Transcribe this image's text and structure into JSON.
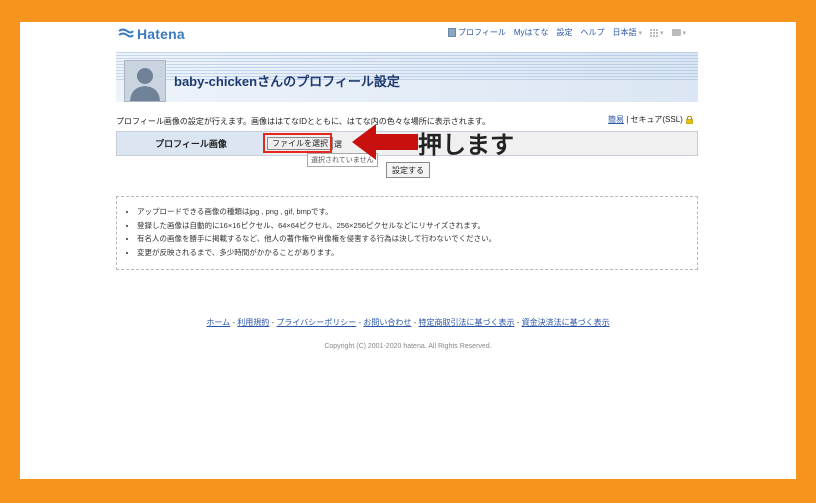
{
  "header": {
    "logo_text": "Hatena",
    "nav": {
      "profile": "プロフィール",
      "my_hatena": "Myはてな",
      "settings": "設定",
      "help": "ヘルプ",
      "language": "日本語"
    }
  },
  "page": {
    "title": "baby-chickenさんのプロフィール設定",
    "description": "プロフィール画像の設定が行えます。画像ははてなIDとともに、はてな内の色々な場所に表示されます。",
    "link_simple": "簡易",
    "link_secure": "セキュア(SSL)"
  },
  "form": {
    "row_label": "プロフィール画像",
    "file_button": "ファイルを選択",
    "file_status": "選",
    "tooltip": "選択されていません",
    "submit_button": "設定する"
  },
  "annotation": {
    "callout_text": "押します",
    "highlight_color": "#e4281f",
    "arrow_color": "#c8100e"
  },
  "notes": [
    "アップロードできる画像の種類はjpg , png , gif, bmpです。",
    "登録した画像は自動的に16×16ピクセル、64×64ピクセル、256×256ピクセルなどにリサイズされます。",
    "有名人の画像を勝手に掲載するなど、他人の著作権や肖像権を侵害する行為は決して行わないでください。",
    "変更が反映されるまで、多少時間がかかることがあります。"
  ],
  "footer": {
    "links": [
      "ホーム",
      "利用規約",
      "プライバシーポリシー",
      "お問い合わせ",
      "特定商取引法に基づく表示",
      "資金決済法に基づく表示"
    ],
    "copyright": "Copyright (C) 2001-2020 hatena. All Rights Reserved."
  },
  "colors": {
    "frame": "#f7941d",
    "link": "#2a56a8",
    "title": "#1e3a6e"
  }
}
